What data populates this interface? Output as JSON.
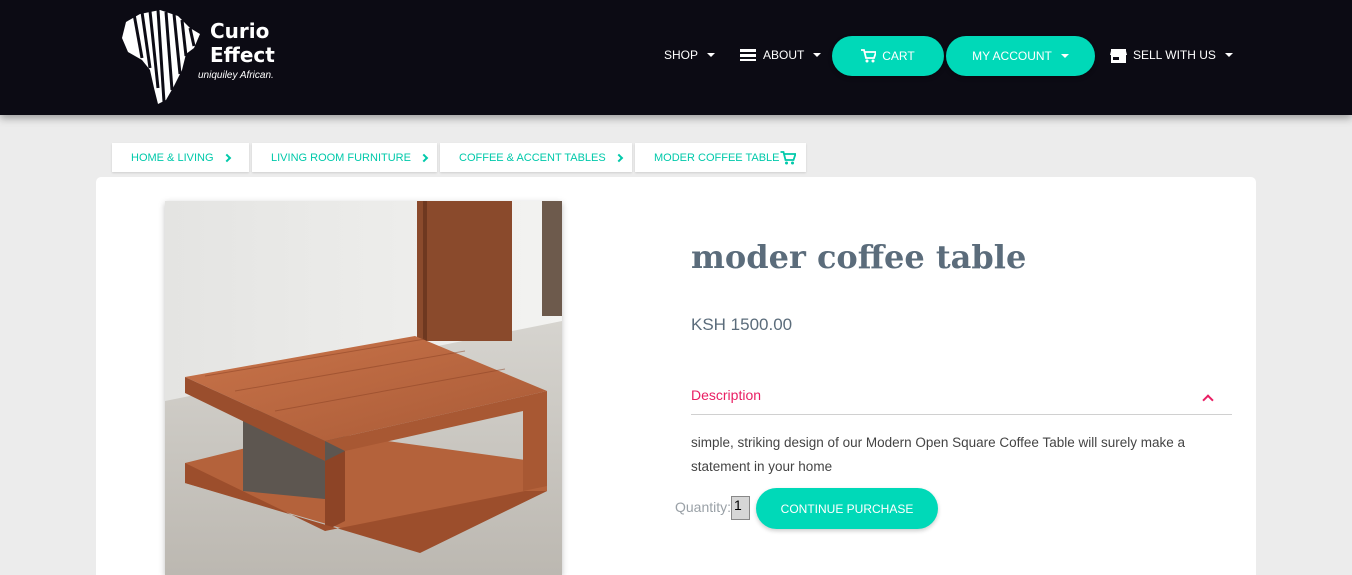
{
  "header": {
    "logo": {
      "line1": "Curio",
      "line2": "Effect",
      "tagline": "uniquiley African."
    },
    "nav": {
      "shop": "SHOP",
      "about": "ABOUT",
      "cart": "CART",
      "my_account": "MY ACCOUNT",
      "sell_with_us": "SELL WITH US"
    }
  },
  "breadcrumbs": [
    {
      "label": "HOME & LIVING"
    },
    {
      "label": "LIVING ROOM FURNITURE"
    },
    {
      "label": "COFFEE & ACCENT TABLES"
    },
    {
      "label": "MODER COFFEE TABLE"
    }
  ],
  "product": {
    "title": "moder coffee table",
    "price": "KSH 1500.00",
    "description_label": "Description",
    "description": "simple, striking design of our Modern Open Square Coffee Table will surely make a statement in your home",
    "quantity_label": "Quantity:",
    "quantity_value": "1",
    "continue_label": "CONTINUE PURCHASE"
  },
  "colors": {
    "accent": "#00d9b8",
    "header_bg": "#0c0b14",
    "description": "#e91e63",
    "title": "#5b6c7b"
  },
  "icons": [
    "cart-icon",
    "about-icon",
    "store-icon",
    "chevron-right-icon",
    "chevron-up-icon"
  ]
}
